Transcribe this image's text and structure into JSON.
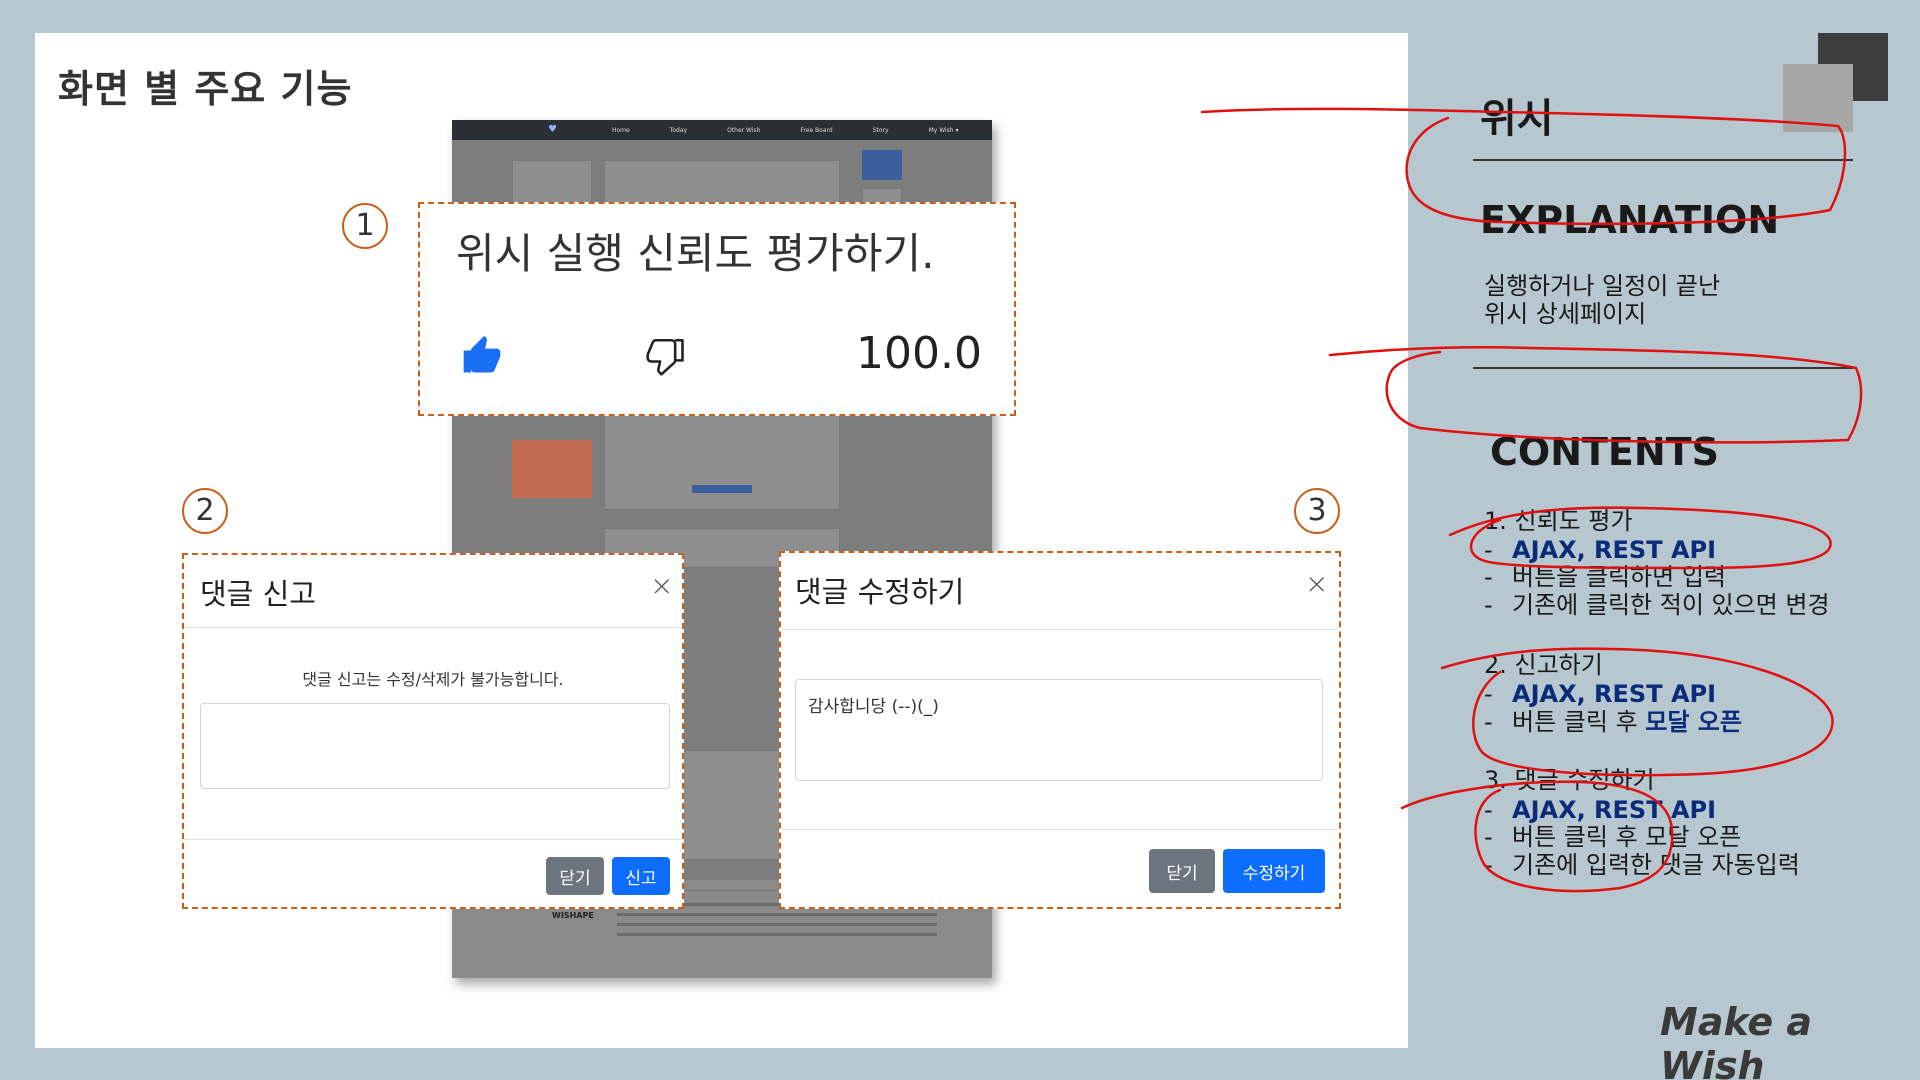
{
  "slide": {
    "title": "화면 별 주요 기능",
    "brand": "Make a Wish"
  },
  "app_screenshot": {
    "nav_items": [
      "Home",
      "Today",
      "Other Wish",
      "Free Board",
      "Story",
      "My Wish ▾"
    ],
    "footer_brand": "WISHAPE"
  },
  "callout1": {
    "number": "1",
    "title": "위시 실행 신뢰도 평가하기.",
    "like_icon": "thumbs-up-icon",
    "dislike_icon": "thumbs-down-icon",
    "score": "100.0"
  },
  "callout2": {
    "number": "2",
    "title": "댓글 신고",
    "close_label": "×",
    "message": "댓글 신고는 수정/삭제가 불가능합니다.",
    "textarea_value": "",
    "close_button": "닫기",
    "submit_button": "신고"
  },
  "callout3": {
    "number": "3",
    "title": "댓글 수정하기",
    "close_label": "×",
    "textarea_value": "감사합니당 (--)(_)",
    "close_button": "닫기",
    "submit_button": "수정하기"
  },
  "right_panel": {
    "page_name": "위시",
    "explanation_heading": "EXPLANATION",
    "explanation_lines": [
      "실행하거나 일정이 끝난",
      "위시 상세페이지"
    ],
    "contents_heading": "CONTENTS",
    "sections": [
      {
        "title": "1. 신뢰도 평가",
        "items": [
          {
            "dash": "-",
            "text": "AJAX, REST API",
            "keyword": true
          },
          {
            "dash": "-",
            "text": "버튼을 클릭하면 입력",
            "keyword": false
          },
          {
            "dash": "-",
            "text": "기존에 클릭한 적이 있으면 변경",
            "keyword": false
          }
        ]
      },
      {
        "title": "2. 신고하기",
        "items": [
          {
            "dash": "-",
            "text": "AJAX, REST API",
            "keyword": true
          },
          {
            "dash": "-",
            "text_plain": "버튼 클릭 후 ",
            "text_kw": "모달 오픈"
          }
        ]
      },
      {
        "title": "3. 댓글 수정하기",
        "items": [
          {
            "dash": "-",
            "text": "AJAX, REST API",
            "keyword": true
          },
          {
            "dash": "-",
            "text": "버튼 클릭 후 모달 오픈",
            "keyword": false
          },
          {
            "dash": "-",
            "text": "기존에 입력한 댓글 자동입력",
            "keyword": false
          }
        ]
      }
    ]
  },
  "colors": {
    "background": "#b6c7d0",
    "callout_border": "#c8601c",
    "annotation_red": "#e01010",
    "keyword_blue": "#0a2a7a",
    "primary_button": "#0d6efd",
    "secondary_button": "#6c757d"
  }
}
